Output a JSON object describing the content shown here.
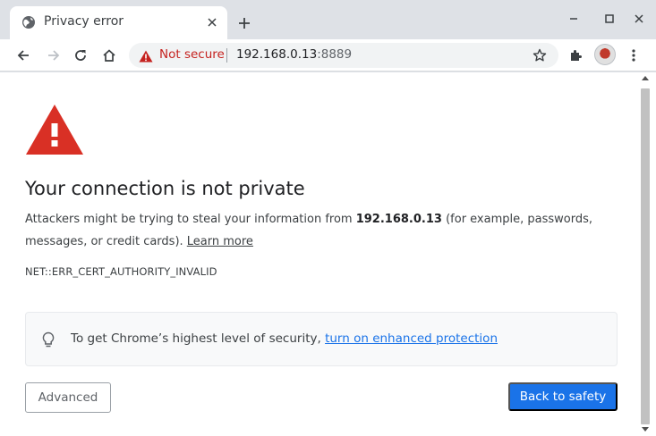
{
  "tab": {
    "title": "Privacy error",
    "favicon": "globe-icon"
  },
  "window_controls": [
    "minimize-icon",
    "maximize-icon",
    "close-icon"
  ],
  "toolbar": {
    "security_label": "Not secure",
    "url_host": "192.168.0.13",
    "url_port": ":8889"
  },
  "page": {
    "heading": "Your connection is not private",
    "desc_before": "Attackers might be trying to steal your information from ",
    "desc_host": "192.168.0.13",
    "desc_after": " (for example, passwords, messages, or credit cards). ",
    "learn_more": "Learn more",
    "error_code": "NET::ERR_CERT_AUTHORITY_INVALID",
    "info_text": "To get Chrome’s highest level of security, ",
    "info_link": "turn on enhanced protection",
    "advanced_label": "Advanced",
    "back_label": "Back to safety"
  },
  "colors": {
    "warning_red": "#d93025",
    "not_secure_red": "#c5221f",
    "primary_blue": "#1a73e8"
  }
}
